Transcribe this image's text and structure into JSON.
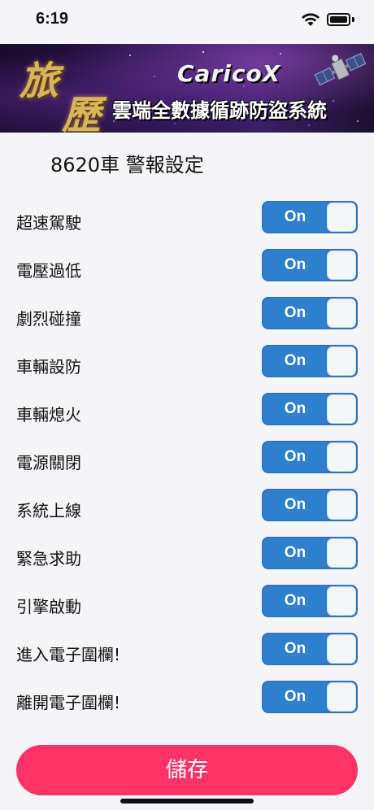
{
  "status_bar": {
    "time": "6:19",
    "wifi_icon": "wifi-icon",
    "battery_icon": "battery-icon"
  },
  "banner": {
    "logo_char_1": "旅",
    "logo_char_2": "歷",
    "brand": "CaricoX",
    "subtitle": "雲端全數據循跡防盜系統",
    "satellite_icon": "satellite-icon"
  },
  "title": "8620車 警報設定",
  "settings": [
    {
      "label": "超速駕駛",
      "toggle": "On"
    },
    {
      "label": "電壓過低",
      "toggle": "On"
    },
    {
      "label": "劇烈碰撞",
      "toggle": "On"
    },
    {
      "label": "車輛設防",
      "toggle": "On"
    },
    {
      "label": "車輛熄火",
      "toggle": "On"
    },
    {
      "label": "電源關閉",
      "toggle": "On"
    },
    {
      "label": "系統上線",
      "toggle": "On"
    },
    {
      "label": "緊急求助",
      "toggle": "On"
    },
    {
      "label": "引擎啟動",
      "toggle": "On"
    },
    {
      "label": "進入電子圍欄!",
      "toggle": "On"
    },
    {
      "label": "離開電子圍欄!",
      "toggle": "On"
    }
  ],
  "save_button": {
    "label": "儲存"
  },
  "colors": {
    "toggle_on": "#2e7fce",
    "save_button": "#ff3366",
    "page_background": "#f5f5f7"
  }
}
